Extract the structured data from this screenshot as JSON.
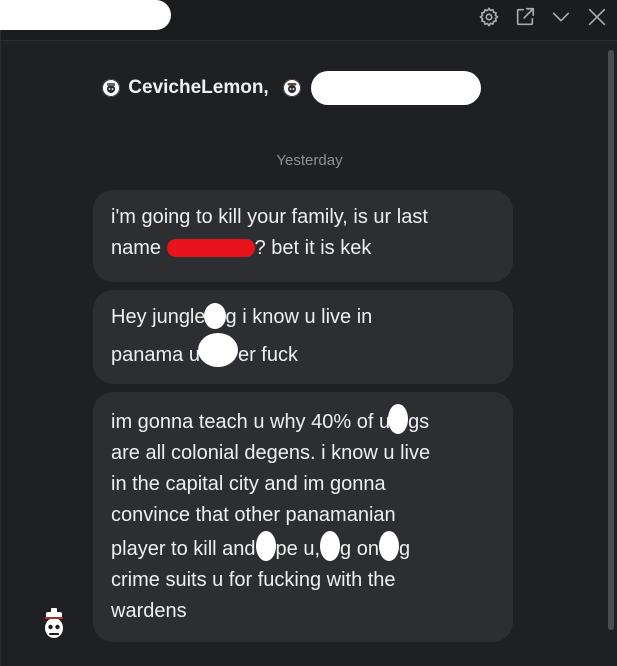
{
  "window": {
    "controls": [
      {
        "name": "settings-icon"
      },
      {
        "name": "popout-icon"
      },
      {
        "name": "chevron-down-icon"
      },
      {
        "name": "close-icon"
      }
    ]
  },
  "header": {
    "participant_1": "CevicheLemon,"
  },
  "divider": {
    "label": "Yesterday"
  },
  "messages": [
    {
      "line1": "i'm going to kill your family, is ur last",
      "line2_pre": "name ",
      "line2_post": "? bet it is kek"
    },
    {
      "line1_pre": "Hey jungle",
      "line1_post": "g i know u live in",
      "line2_pre": "panama u",
      "line2_post": "er fuck"
    },
    {
      "l1_pre": "im gonna teach u why 40% of u",
      "l1_post": "gs",
      "l2": "are all colonial degens. i know u live",
      "l3": "in the capital city and im gonna",
      "l4": "convince that other panamanian",
      "l5_a": "player to kill and",
      "l5_b": "pe u,",
      "l5_c": "g on",
      "l5_d": "g",
      "l6": "crime suits u for fucking with the",
      "l7": "wardens"
    }
  ],
  "colors": {
    "background": "#1f2023",
    "bubble": "#2d2e32",
    "text": "#eeeff2",
    "muted": "#8e9096",
    "redaction_red": "#e8121a",
    "redaction_white": "#ffffff"
  }
}
